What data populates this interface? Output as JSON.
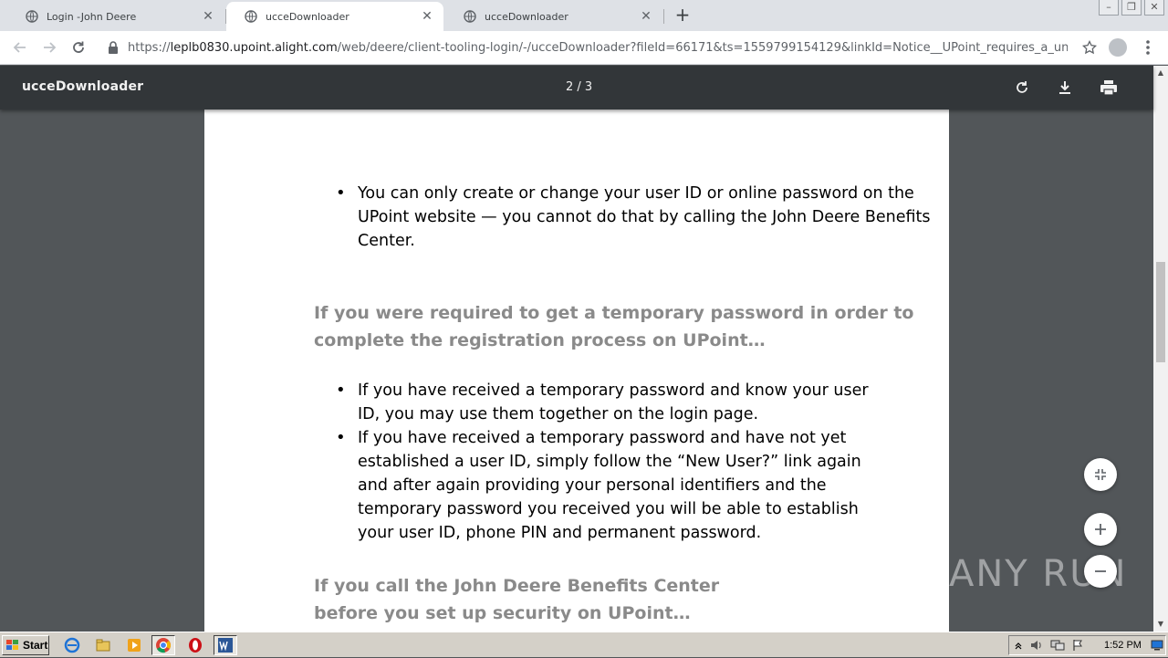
{
  "browser": {
    "tabs": [
      {
        "title": "Login -John Deere",
        "active": false
      },
      {
        "title": "ucceDownloader",
        "active": true
      },
      {
        "title": "ucceDownloader",
        "active": false
      }
    ],
    "new_tab": "+",
    "url_prefix": "https://",
    "url_host": "leplb0830.upoint.alight.com",
    "url_path": "/web/deere/client-tooling-login/-/ucceDownloader?fileId=66171&ts=1559799154129&linkId=Notice__UPoint_requires_a_unique_l..."
  },
  "pdf": {
    "title": "ucceDownloader",
    "page_indicator": "2 / 3",
    "content": {
      "bullets_1": [
        "You can only create or change your user ID or online password on the UPoint website — you cannot do that by calling the John Deere Benefits Center."
      ],
      "heading_1_line1": "If you were required to get a temporary password in order to",
      "heading_1_line2": "complete the registration process on UPoint…",
      "bullets_2": [
        "If you have received a temporary password and know your user ID, you may use them together on the login page.",
        "If you have received a temporary password and have not yet established a user ID, simply follow the “New User?” link again and after again providing your personal identifiers and the temporary password you received you will be able to establish your user ID, phone PIN and permanent password."
      ],
      "heading_2_line1": "If you call the John Deere Benefits Center",
      "heading_2_line2": "before you set up security on UPoint…"
    }
  },
  "watermark": "ANY RUN",
  "taskbar": {
    "start_label": "Start",
    "clock": "1:52 PM"
  },
  "icons": [
    "globe-icon",
    "close-icon",
    "back-arrow-icon",
    "forward-arrow-icon",
    "reload-icon",
    "lock-icon",
    "star-icon",
    "avatar-icon",
    "kebab-menu-icon",
    "rotate-icon",
    "download-icon",
    "print-icon",
    "fit-page-icon",
    "zoom-in-icon",
    "zoom-out-icon"
  ]
}
